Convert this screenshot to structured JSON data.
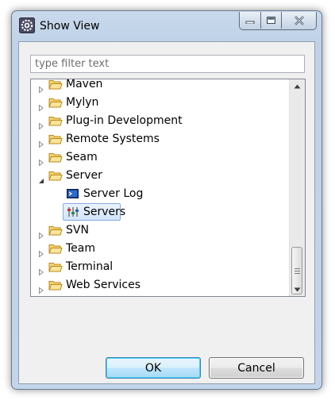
{
  "window": {
    "title": "Show View"
  },
  "filter": {
    "placeholder": "type filter text",
    "value": ""
  },
  "tree": {
    "items": [
      {
        "label": "Maven",
        "type": "folder",
        "expanded": false,
        "level": 0
      },
      {
        "label": "Mylyn",
        "type": "folder",
        "expanded": false,
        "level": 0
      },
      {
        "label": "Plug-in Development",
        "type": "folder",
        "expanded": false,
        "level": 0
      },
      {
        "label": "Remote Systems",
        "type": "folder",
        "expanded": false,
        "level": 0
      },
      {
        "label": "Seam",
        "type": "folder",
        "expanded": false,
        "level": 0
      },
      {
        "label": "Server",
        "type": "folder",
        "expanded": true,
        "level": 0
      },
      {
        "label": "Server Log",
        "type": "view",
        "icon": "server-log-icon",
        "level": 1
      },
      {
        "label": "Servers",
        "type": "view",
        "icon": "servers-icon",
        "level": 1,
        "selected": true
      },
      {
        "label": "SVN",
        "type": "folder",
        "expanded": false,
        "level": 0
      },
      {
        "label": "Team",
        "type": "folder",
        "expanded": false,
        "level": 0
      },
      {
        "label": "Terminal",
        "type": "folder",
        "expanded": false,
        "level": 0
      },
      {
        "label": "Web Services",
        "type": "folder",
        "expanded": false,
        "level": 0
      }
    ]
  },
  "buttons": {
    "ok_label": "OK",
    "cancel_label": "Cancel"
  },
  "colors": {
    "folder_fill": "#f5d46d",
    "folder_stroke": "#b88a1c",
    "selection_border": "#84acdd",
    "ok_border": "#3c7fb1"
  }
}
